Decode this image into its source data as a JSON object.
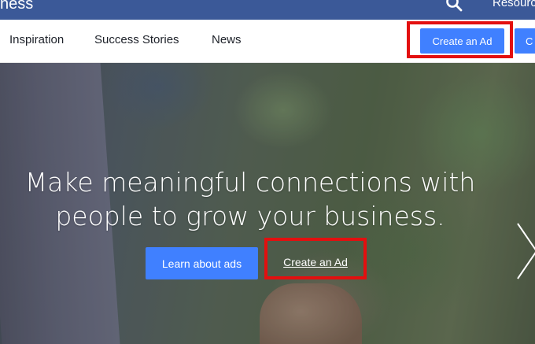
{
  "topbar": {
    "brand": "ness",
    "resources": "Resourc",
    "icons": {
      "search": "search-icon"
    }
  },
  "nav": {
    "links": [
      "Inspiration",
      "Success Stories",
      "News"
    ],
    "create_ad_button": "Create an Ad",
    "partial_button": "C"
  },
  "hero": {
    "headline": "Make meaningful connections with people to grow your business.",
    "learn_button": "Learn about ads",
    "create_link": "Create an Ad",
    "icons": {
      "next": "chevron-right-icon"
    }
  },
  "colors": {
    "topbar": "#3b5998",
    "button": "#4080ff",
    "highlight": "#e30f0f"
  }
}
